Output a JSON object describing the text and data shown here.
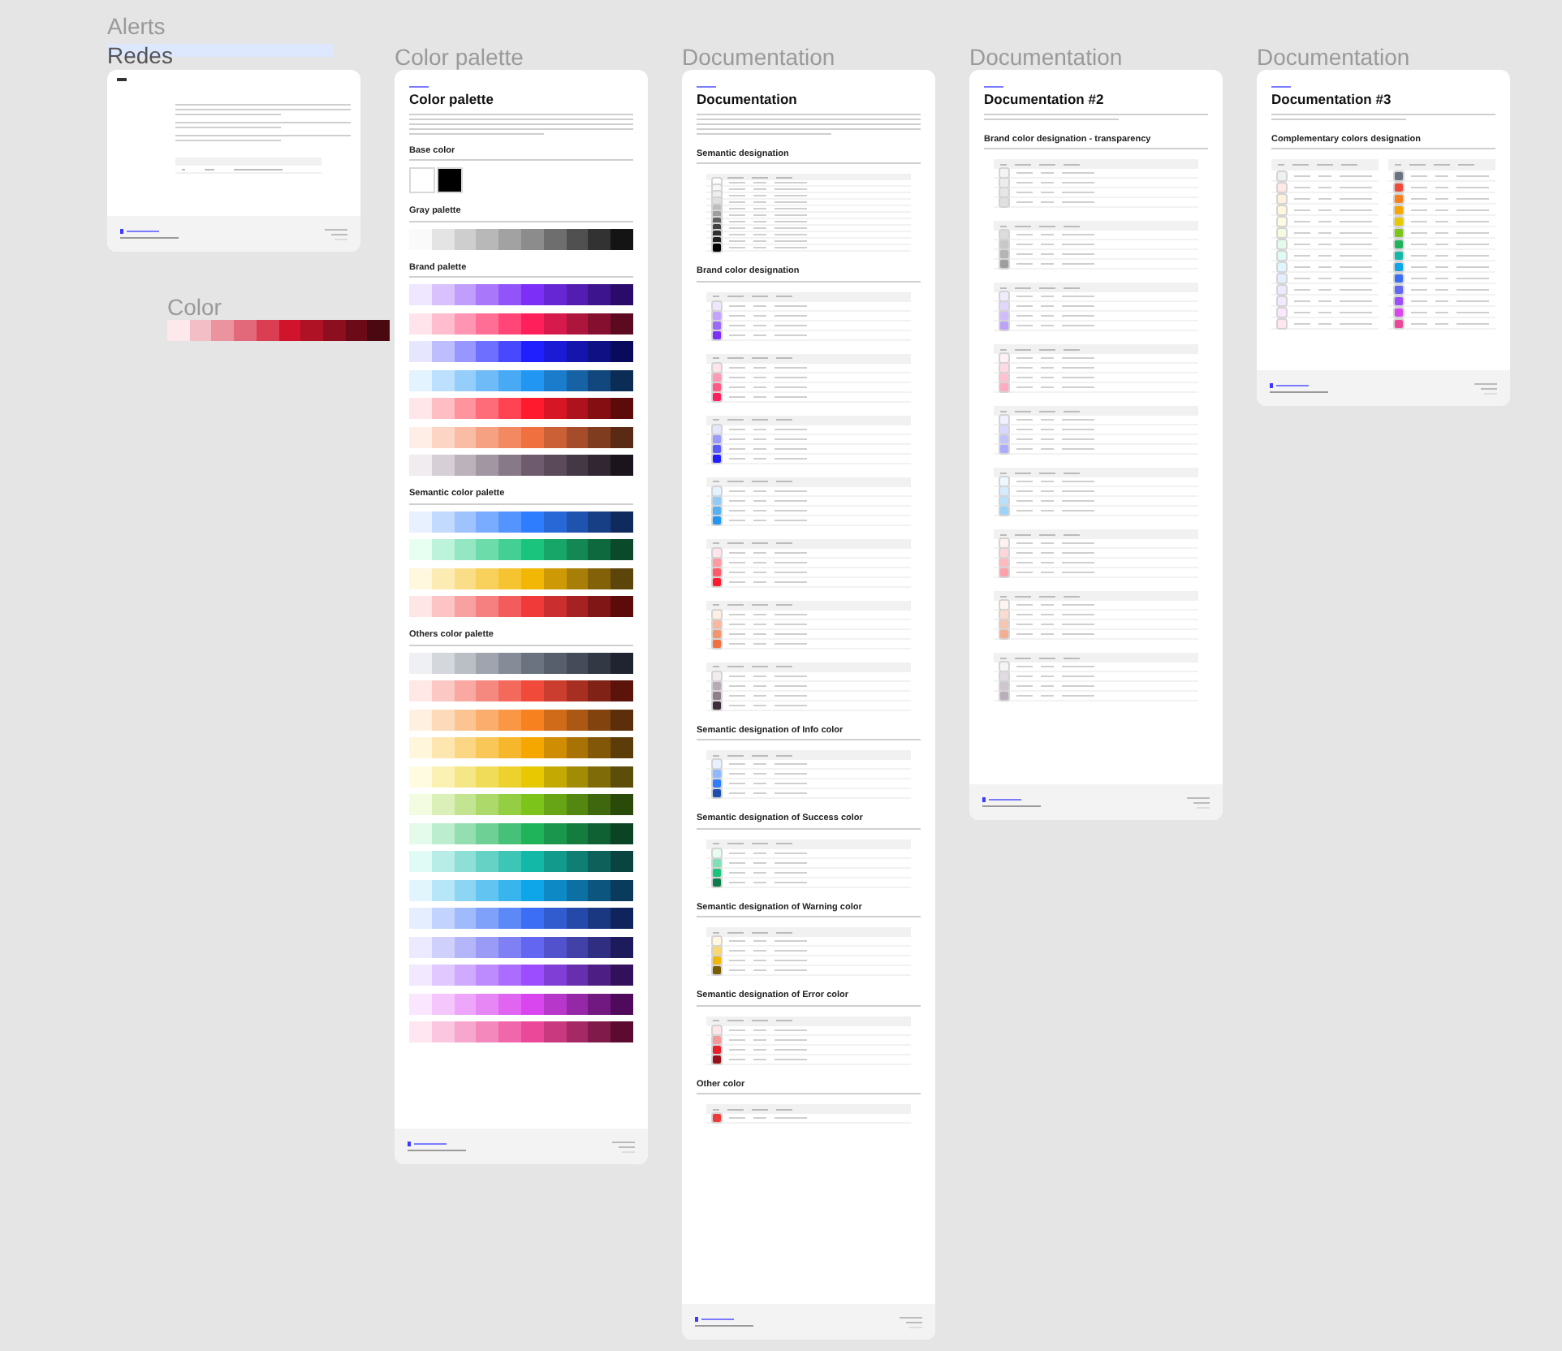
{
  "alerts_frame": {
    "label_top": "Alerts",
    "label": "Redes"
  },
  "color_strip": {
    "label": "Color",
    "stops": [
      {
        "color": "#fde8ec"
      },
      {
        "color": "#d0142c"
      },
      {
        "color": "#4a0810"
      }
    ]
  },
  "palette_frame": {
    "label": "Color palette",
    "title": "Color palette",
    "base": {
      "title": "Base color",
      "swatches": [
        {
          "color": "#ffffff"
        },
        {
          "color": "#000000"
        }
      ]
    },
    "sections": [
      {
        "title": "Gray palette",
        "rows": [
          {
            "stops": [
              {
                "color": "#fafafa"
              },
              {
                "color": "#8c8c8c"
              },
              {
                "color": "#141414"
              }
            ]
          }
        ]
      },
      {
        "title": "Brand palette",
        "rows": [
          {
            "stops": [
              {
                "color": "#efe6ff"
              },
              {
                "color": "#7b2ff7"
              },
              {
                "color": "#2a0a6b"
              }
            ]
          },
          {
            "stops": [
              {
                "color": "#ffe4ec"
              },
              {
                "color": "#ff1f5a"
              },
              {
                "color": "#5c0a1f"
              }
            ]
          },
          {
            "stops": [
              {
                "color": "#e6e6ff"
              },
              {
                "color": "#2020ff"
              },
              {
                "color": "#0a0a5c"
              }
            ]
          },
          {
            "stops": [
              {
                "color": "#e3f3ff"
              },
              {
                "color": "#2196f3"
              },
              {
                "color": "#0b2d55"
              }
            ]
          },
          {
            "stops": [
              {
                "color": "#ffe6e9"
              },
              {
                "color": "#ff1a2e"
              },
              {
                "color": "#5c0a0a"
              }
            ]
          },
          {
            "stops": [
              {
                "color": "#ffeee6"
              },
              {
                "color": "#f07040"
              },
              {
                "color": "#5a2a14"
              }
            ]
          },
          {
            "stops": [
              {
                "color": "#f0ecf0"
              },
              {
                "color": "#6e5c6e"
              },
              {
                "color": "#1c141c"
              }
            ]
          }
        ]
      },
      {
        "title": "Semantic color palette",
        "rows": [
          {
            "stops": [
              {
                "color": "#e8f1ff"
              },
              {
                "color": "#2f7dff"
              },
              {
                "color": "#0f2a5c"
              }
            ]
          },
          {
            "stops": [
              {
                "color": "#e6fff1"
              },
              {
                "color": "#1bc47d"
              },
              {
                "color": "#0a4a2a"
              }
            ]
          },
          {
            "stops": [
              {
                "color": "#fff8de"
              },
              {
                "color": "#f2b705"
              },
              {
                "color": "#5c440a"
              }
            ]
          },
          {
            "stops": [
              {
                "color": "#ffe6e6"
              },
              {
                "color": "#f03a3a"
              },
              {
                "color": "#5c0a0a"
              }
            ]
          }
        ]
      },
      {
        "title": "Others color palette",
        "rows": [
          {
            "stops": [
              {
                "color": "#eef0f3"
              },
              {
                "color": "#6b7280"
              },
              {
                "color": "#1f2430"
              }
            ]
          },
          {
            "stops": [
              {
                "color": "#ffe8e6"
              },
              {
                "color": "#f04a3a"
              },
              {
                "color": "#5c140a"
              }
            ]
          },
          {
            "stops": [
              {
                "color": "#fff0e0"
              },
              {
                "color": "#f7811e"
              },
              {
                "color": "#5c2e0a"
              }
            ]
          },
          {
            "stops": [
              {
                "color": "#fff6dc"
              },
              {
                "color": "#f5a700"
              },
              {
                "color": "#5c3d0a"
              }
            ]
          },
          {
            "stops": [
              {
                "color": "#fffbe0"
              },
              {
                "color": "#e8c800"
              },
              {
                "color": "#5c4d0a"
              }
            ]
          },
          {
            "stops": [
              {
                "color": "#f3fbe0"
              },
              {
                "color": "#7cc31a"
              },
              {
                "color": "#2a4a0a"
              }
            ]
          },
          {
            "stops": [
              {
                "color": "#e4fbec"
              },
              {
                "color": "#1fb35a"
              },
              {
                "color": "#0a4424"
              }
            ]
          },
          {
            "stops": [
              {
                "color": "#e0faf6"
              },
              {
                "color": "#14b8a6"
              },
              {
                "color": "#0a4440"
              }
            ]
          },
          {
            "stops": [
              {
                "color": "#e0f6fc"
              },
              {
                "color": "#0ea5e9"
              },
              {
                "color": "#0a3a5c"
              }
            ]
          },
          {
            "stops": [
              {
                "color": "#e4eeff"
              },
              {
                "color": "#3b6ef5"
              },
              {
                "color": "#0f245c"
              }
            ]
          },
          {
            "stops": [
              {
                "color": "#ebeaff"
              },
              {
                "color": "#6366f1"
              },
              {
                "color": "#1e1b5c"
              }
            ]
          },
          {
            "stops": [
              {
                "color": "#f2e8ff"
              },
              {
                "color": "#9b4dff"
              },
              {
                "color": "#33105c"
              }
            ]
          },
          {
            "stops": [
              {
                "color": "#fbe6ff"
              },
              {
                "color": "#d946ef"
              },
              {
                "color": "#4f0a5c"
              }
            ]
          },
          {
            "stops": [
              {
                "color": "#ffe6f1"
              },
              {
                "color": "#ec4899"
              },
              {
                "color": "#5c0a30"
              }
            ]
          }
        ]
      }
    ]
  },
  "docs": [
    {
      "label": "Documentation",
      "title": "Documentation",
      "sections": [
        {
          "title": "Semantic designation",
          "kind": "stack",
          "tables": [
            {
              "rows": [
                {
                  "color": "#ffffff"
                },
                {
                  "color": "#f7f7f7"
                },
                {
                  "color": "#eeeeee"
                },
                {
                  "color": "#e0e0e0"
                },
                {
                  "color": "#bdbdbd"
                },
                {
                  "color": "#9e9e9e"
                },
                {
                  "color": "#616161"
                },
                {
                  "color": "#424242"
                },
                {
                  "color": "#303030"
                },
                {
                  "color": "#212121"
                },
                {
                  "color": "#000000"
                }
              ]
            }
          ]
        },
        {
          "title": "Brand color designation",
          "kind": "stack",
          "tables": [
            {
              "rows": [
                {
                  "color": "#efe6ff"
                },
                {
                  "color": "#c4a4fb"
                },
                {
                  "color": "#9b6af8"
                },
                {
                  "color": "#7b2ff7"
                }
              ]
            },
            {
              "rows": [
                {
                  "color": "#ffe4ec"
                },
                {
                  "color": "#ff9ab5"
                },
                {
                  "color": "#ff5a85"
                },
                {
                  "color": "#ff1f5a"
                }
              ]
            },
            {
              "rows": [
                {
                  "color": "#e6e6ff"
                },
                {
                  "color": "#9a9aff"
                },
                {
                  "color": "#5a5aff"
                },
                {
                  "color": "#2020ff"
                }
              ]
            },
            {
              "rows": [
                {
                  "color": "#e3f3ff"
                },
                {
                  "color": "#90cbf9"
                },
                {
                  "color": "#55b0f6"
                },
                {
                  "color": "#2196f3"
                }
              ]
            },
            {
              "rows": [
                {
                  "color": "#ffe6e9"
                },
                {
                  "color": "#ff9aa3"
                },
                {
                  "color": "#ff5a68"
                },
                {
                  "color": "#ff1a2e"
                }
              ]
            },
            {
              "rows": [
                {
                  "color": "#ffeee6"
                },
                {
                  "color": "#f7b89f"
                },
                {
                  "color": "#f3946f"
                },
                {
                  "color": "#f07040"
                }
              ]
            },
            {
              "rows": [
                {
                  "color": "#f0ecf0"
                },
                {
                  "color": "#b7aab7"
                },
                {
                  "color": "#8e7e8e"
                },
                {
                  "color": "#3c2e3c"
                }
              ]
            }
          ]
        },
        {
          "title": "Semantic designation of Info color",
          "kind": "stack",
          "tables": [
            {
              "rows": [
                {
                  "color": "#e8f1ff"
                },
                {
                  "color": "#8fb9ff"
                },
                {
                  "color": "#2f7dff"
                },
                {
                  "color": "#1a4fb0"
                }
              ]
            }
          ]
        },
        {
          "title": "Semantic designation of Success color",
          "kind": "stack",
          "tables": [
            {
              "rows": [
                {
                  "color": "#e6fff1"
                },
                {
                  "color": "#7ee0b5"
                },
                {
                  "color": "#1bc47d"
                },
                {
                  "color": "#0f7a4c"
                }
              ]
            }
          ]
        },
        {
          "title": "Semantic designation of Warning color",
          "kind": "stack",
          "tables": [
            {
              "rows": [
                {
                  "color": "#fff8de"
                },
                {
                  "color": "#f8d870"
                },
                {
                  "color": "#f2b705"
                },
                {
                  "color": "#7a5c05"
                }
              ]
            }
          ]
        },
        {
          "title": "Semantic designation of Error color",
          "kind": "stack",
          "tables": [
            {
              "rows": [
                {
                  "color": "#ffe6e6"
                },
                {
                  "color": "#f59a9a"
                },
                {
                  "color": "#e8202a"
                },
                {
                  "color": "#9a1018"
                }
              ]
            }
          ]
        },
        {
          "title": "Other color",
          "kind": "stack",
          "tables": [
            {
              "rows": [
                {
                  "color": "#f03a3a"
                }
              ]
            }
          ]
        }
      ]
    },
    {
      "label": "Documentation",
      "title": "Documentation #2",
      "sections": [
        {
          "title": "Brand color designation - transparency",
          "kind": "stack",
          "tables": [
            {
              "rows": [
                {
                  "color": "#f4f4f4"
                },
                {
                  "color": "#ececec"
                },
                {
                  "color": "#e6e6e6"
                },
                {
                  "color": "#e0e0e0"
                }
              ]
            },
            {
              "rows": [
                {
                  "color": "#dddddd"
                },
                {
                  "color": "#c8c8c8"
                },
                {
                  "color": "#b4b4b4"
                },
                {
                  "color": "#9e9e9e"
                }
              ]
            },
            {
              "rows": [
                {
                  "color": "#f1ebff"
                },
                {
                  "color": "#e2d6fd"
                },
                {
                  "color": "#d0bcfb"
                },
                {
                  "color": "#bda2fa"
                }
              ]
            },
            {
              "rows": [
                {
                  "color": "#fff0f4"
                },
                {
                  "color": "#ffd9e3"
                },
                {
                  "color": "#ffc2d2"
                },
                {
                  "color": "#ffabc1"
                }
              ]
            },
            {
              "rows": [
                {
                  "color": "#f0f0ff"
                },
                {
                  "color": "#d9d9ff"
                },
                {
                  "color": "#c2c2ff"
                },
                {
                  "color": "#ababff"
                }
              ]
            },
            {
              "rows": [
                {
                  "color": "#eef7ff"
                },
                {
                  "color": "#d3ebfd"
                },
                {
                  "color": "#b8dffb"
                },
                {
                  "color": "#9dd3fa"
                }
              ]
            },
            {
              "rows": [
                {
                  "color": "#fff0f1"
                },
                {
                  "color": "#ffd5d9"
                },
                {
                  "color": "#ffbac0"
                },
                {
                  "color": "#ff9fa8"
                }
              ]
            },
            {
              "rows": [
                {
                  "color": "#fff4ef"
                },
                {
                  "color": "#fcdcd0"
                },
                {
                  "color": "#f8c5b1"
                },
                {
                  "color": "#f5ae92"
                }
              ]
            },
            {
              "rows": [
                {
                  "color": "#f6f3f6"
                },
                {
                  "color": "#e2dce2"
                },
                {
                  "color": "#cec5ce"
                },
                {
                  "color": "#baaeba"
                }
              ]
            }
          ]
        }
      ]
    },
    {
      "label": "Documentation",
      "title": "Documentation #3",
      "sections": [
        {
          "title": "Complementary colors designation",
          "kind": "pair",
          "tables": [
            {
              "rows": [
                {
                  "color": "#eef0f3"
                },
                {
                  "color": "#ffe8e6"
                },
                {
                  "color": "#fff0e0"
                },
                {
                  "color": "#fff6dc"
                },
                {
                  "color": "#fffbe0"
                },
                {
                  "color": "#f3fbe0"
                },
                {
                  "color": "#e4fbec"
                },
                {
                  "color": "#e0faf6"
                },
                {
                  "color": "#e0f6fc"
                },
                {
                  "color": "#e4eeff"
                },
                {
                  "color": "#ebeaff"
                },
                {
                  "color": "#f2e8ff"
                },
                {
                  "color": "#fbe6ff"
                },
                {
                  "color": "#ffe6f1"
                }
              ]
            },
            {
              "rows": [
                {
                  "color": "#6b7280"
                },
                {
                  "color": "#f04a3a"
                },
                {
                  "color": "#f7811e"
                },
                {
                  "color": "#f5a700"
                },
                {
                  "color": "#e8c800"
                },
                {
                  "color": "#7cc31a"
                },
                {
                  "color": "#1fb35a"
                },
                {
                  "color": "#14b8a6"
                },
                {
                  "color": "#0ea5e9"
                },
                {
                  "color": "#3b6ef5"
                },
                {
                  "color": "#6366f1"
                },
                {
                  "color": "#9b4dff"
                },
                {
                  "color": "#d946ef"
                },
                {
                  "color": "#ec4899"
                }
              ]
            }
          ]
        }
      ]
    }
  ]
}
